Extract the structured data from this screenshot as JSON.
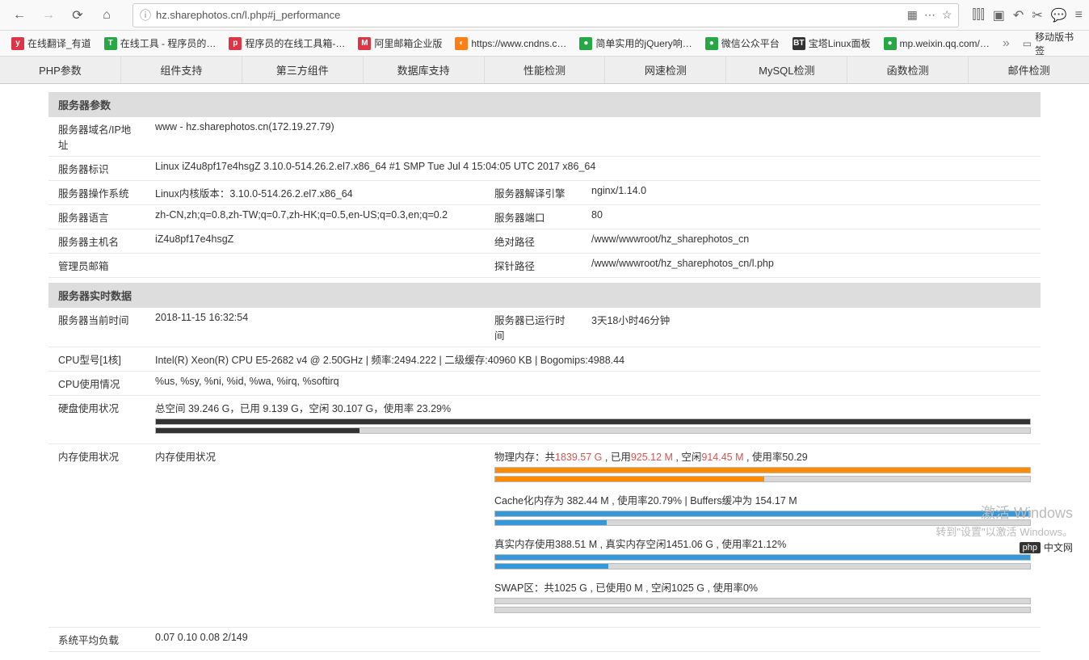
{
  "browser": {
    "url_display": "hz.sharephotos.cn/l.php#j_performance"
  },
  "bookmarks": [
    {
      "icon_class": "ic-y",
      "icon_text": "y",
      "label": "在线翻译_有道"
    },
    {
      "icon_class": "ic-t",
      "icon_text": "T",
      "label": "在线工具 - 程序员的…"
    },
    {
      "icon_class": "ic-php",
      "icon_text": "p",
      "label": "程序员的在线工具箱-…"
    },
    {
      "icon_class": "ic-m",
      "icon_text": "M",
      "label": "阿里邮箱企业版"
    },
    {
      "icon_class": "ic-o",
      "icon_text": "◐",
      "label": "https://www.cndns.c…"
    },
    {
      "icon_class": "ic-pl",
      "icon_text": "●",
      "label": "简单实用的jQuery响…"
    },
    {
      "icon_class": "ic-wx",
      "icon_text": "●",
      "label": "微信公众平台"
    },
    {
      "icon_class": "ic-bt",
      "icon_text": "BT",
      "label": "宝塔Linux面板"
    },
    {
      "icon_class": "ic-wx2",
      "icon_text": "●",
      "label": "mp.weixin.qq.com/…"
    }
  ],
  "bookmark_end": "移动版书签",
  "tabs": [
    "PHP参数",
    "组件支持",
    "第三方组件",
    "数据库支持",
    "性能检测",
    "网速检测",
    "MySQL检测",
    "函数检测",
    "邮件检测"
  ],
  "section1": {
    "title": "服务器参数",
    "rows": [
      {
        "label": "服务器域名/IP地址",
        "value": "www - hz.sharephotos.cn(172.19.27.79)"
      },
      {
        "label": "服务器标识",
        "value": "Linux iZ4u8pf17e4hsgZ 3.10.0-514.26.2.el7.x86_64 #1 SMP Tue Jul 4 15:04:05 UTC 2017 x86_64"
      },
      {
        "label": "服务器操作系统",
        "value": "Linux内核版本：3.10.0-514.26.2.el7.x86_64",
        "label2": "服务器解译引擎",
        "value2": "nginx/1.14.0"
      },
      {
        "label": "服务器语言",
        "value": "zh-CN,zh;q=0.8,zh-TW;q=0.7,zh-HK;q=0.5,en-US;q=0.3,en;q=0.2",
        "label2": "服务器端口",
        "value2": "80"
      },
      {
        "label": "服务器主机名",
        "value": "iZ4u8pf17e4hsgZ",
        "label2": "绝对路径",
        "value2": "/www/wwwroot/hz_sharephotos_cn"
      },
      {
        "label": "管理员邮箱",
        "value": "",
        "label2": "探针路径",
        "value2": "/www/wwwroot/hz_sharephotos_cn/l.php"
      }
    ]
  },
  "section2": {
    "title": "服务器实时数据",
    "time_label": "服务器当前时间",
    "time_value": "2018-11-15 16:32:54",
    "uptime_label": "服务器已运行时间",
    "uptime_value": "3天18小时46分钟",
    "cpu_label": "CPU型号[1核]",
    "cpu_value": "Intel(R) Xeon(R) CPU E5-2682 v4 @ 2.50GHz | 频率:2494.222 | 二级缓存:40960 KB | Bogomips:4988.44",
    "cpu_usage_label": "CPU使用情况",
    "cpu_usage_value": "%us, %sy, %ni, %id, %wa, %irq, %softirq",
    "disk_label": "硬盘使用状况",
    "disk_text": "总空间 39.246 G，已用 9.139 G，空闲 30.107 G，使用率 23.29%",
    "disk_pct": 23.29,
    "mem_label": "内存使用状况",
    "mem_sub_label": "内存使用状况",
    "phys_prefix": "物理内存：共",
    "phys_total": "1839.57 G",
    "phys_used_prefix": " , 已用",
    "phys_used": "925.12 M",
    "phys_free_prefix": " , 空闲",
    "phys_free": "914.45 M",
    "phys_rate_prefix": " , 使用率",
    "phys_rate": "50.29",
    "phys_pct": 50.29,
    "cache_text": "Cache化内存为 382.44 M , 使用率20.79% | Buffers缓冲为 154.17 M",
    "cache_pct": 20.79,
    "real_text": "真实内存使用388.51 M , 真实内存空闲1451.06 G , 使用率21.12%",
    "real_pct": 21.12,
    "swap_text": "SWAP区：共1025 G , 已使用0 M , 空闲1025 G , 使用率0%",
    "swap_pct": 0,
    "load_label": "系统平均负载",
    "load_value": "0.07 0.10 0.08 2/149"
  },
  "watermark": {
    "line1": "激活 Windows",
    "line2": "转到\"设置\"以激活 Windows。"
  },
  "php_logo": "中文网"
}
